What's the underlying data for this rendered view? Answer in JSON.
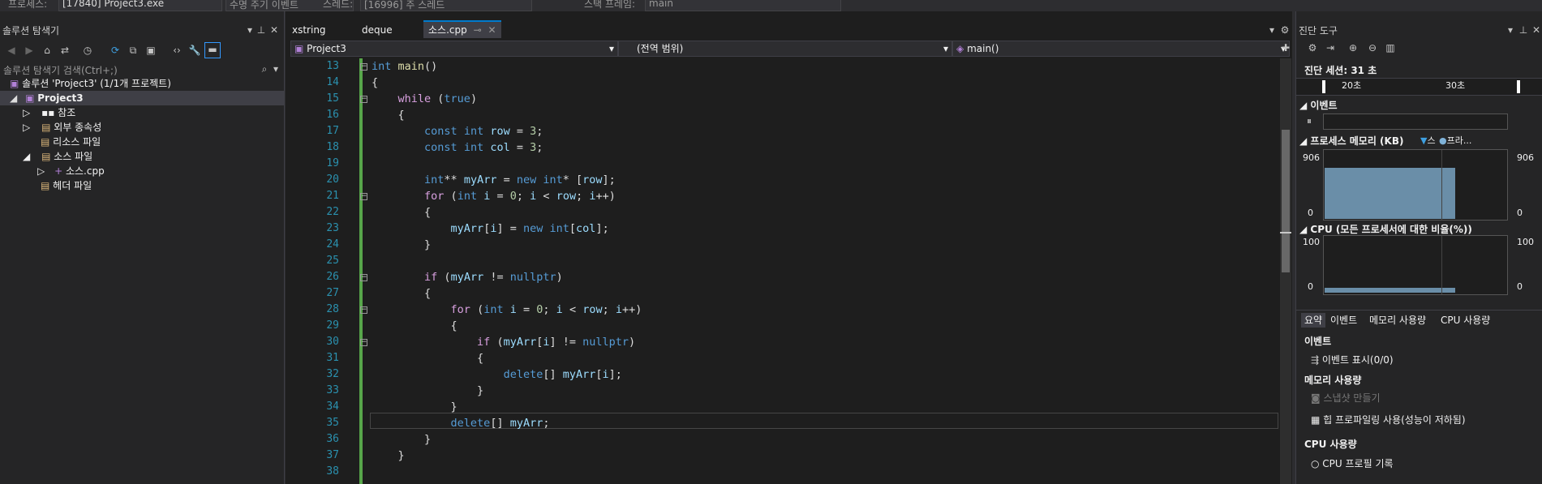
{
  "topbar": {
    "process_label": "프로세스:",
    "process_value": "[17840] Project3.exe",
    "lifecycle_label": "수명 주기 이벤트",
    "thread_label": "스레드:",
    "thread_value": "[16996] 주 스레드",
    "stack_label": "스택 프레임:",
    "stack_value": "main"
  },
  "solution_explorer": {
    "title": "솔루션 탐색기",
    "search_placeholder": "솔루션 탐색기 검색(Ctrl+;)",
    "tree": [
      {
        "label": "솔루션 'Project3' (1/1개 프로젝트)"
      },
      {
        "label": "Project3"
      },
      {
        "label": "참조"
      },
      {
        "label": "외부 종속성"
      },
      {
        "label": "리소스 파일"
      },
      {
        "label": "소스 파일"
      },
      {
        "label": "소스.cpp"
      },
      {
        "label": "헤더 파일"
      }
    ]
  },
  "editor": {
    "tabs": [
      {
        "label": "xstring"
      },
      {
        "label": "deque"
      },
      {
        "label": "소스.cpp"
      }
    ],
    "nav": {
      "project": "Project3",
      "scope": "(전역 범위)",
      "member": "main()"
    },
    "lines": [
      {
        "num": "13",
        "tokens": [
          [
            "kw",
            "int"
          ],
          [
            "t",
            " "
          ],
          [
            "fn",
            "main"
          ],
          [
            "t",
            "()"
          ]
        ]
      },
      {
        "num": "14",
        "tokens": [
          [
            "t",
            "{"
          ]
        ]
      },
      {
        "num": "15",
        "tokens": [
          [
            "t",
            "    "
          ],
          [
            "ctl",
            "while"
          ],
          [
            "t",
            " ("
          ],
          [
            "kw",
            "true"
          ],
          [
            "t",
            ")"
          ]
        ]
      },
      {
        "num": "16",
        "tokens": [
          [
            "t",
            "    {"
          ]
        ]
      },
      {
        "num": "17",
        "tokens": [
          [
            "t",
            "        "
          ],
          [
            "kw",
            "const"
          ],
          [
            "t",
            " "
          ],
          [
            "kw",
            "int"
          ],
          [
            "t",
            " "
          ],
          [
            "var",
            "row"
          ],
          [
            "t",
            " = "
          ],
          [
            "num",
            "3"
          ],
          [
            "t",
            ";"
          ]
        ]
      },
      {
        "num": "18",
        "tokens": [
          [
            "t",
            "        "
          ],
          [
            "kw",
            "const"
          ],
          [
            "t",
            " "
          ],
          [
            "kw",
            "int"
          ],
          [
            "t",
            " "
          ],
          [
            "var",
            "col"
          ],
          [
            "t",
            " = "
          ],
          [
            "num",
            "3"
          ],
          [
            "t",
            ";"
          ]
        ]
      },
      {
        "num": "19",
        "tokens": []
      },
      {
        "num": "20",
        "tokens": [
          [
            "t",
            "        "
          ],
          [
            "kw",
            "int"
          ],
          [
            "t",
            "** "
          ],
          [
            "var",
            "myArr"
          ],
          [
            "t",
            " = "
          ],
          [
            "kw",
            "new"
          ],
          [
            "t",
            " "
          ],
          [
            "kw",
            "int"
          ],
          [
            "t",
            "* ["
          ],
          [
            "var",
            "row"
          ],
          [
            "t",
            "];"
          ]
        ]
      },
      {
        "num": "21",
        "tokens": [
          [
            "t",
            "        "
          ],
          [
            "ctl",
            "for"
          ],
          [
            "t",
            " ("
          ],
          [
            "kw",
            "int"
          ],
          [
            "t",
            " "
          ],
          [
            "var",
            "i"
          ],
          [
            "t",
            " = "
          ],
          [
            "num",
            "0"
          ],
          [
            "t",
            "; "
          ],
          [
            "var",
            "i"
          ],
          [
            "t",
            " < "
          ],
          [
            "var",
            "row"
          ],
          [
            "t",
            "; "
          ],
          [
            "var",
            "i"
          ],
          [
            "t",
            "++)"
          ]
        ]
      },
      {
        "num": "22",
        "tokens": [
          [
            "t",
            "        {"
          ]
        ]
      },
      {
        "num": "23",
        "tokens": [
          [
            "t",
            "            "
          ],
          [
            "var",
            "myArr"
          ],
          [
            "t",
            "["
          ],
          [
            "var",
            "i"
          ],
          [
            "t",
            "] = "
          ],
          [
            "kw",
            "new"
          ],
          [
            "t",
            " "
          ],
          [
            "kw",
            "int"
          ],
          [
            "t",
            "["
          ],
          [
            "var",
            "col"
          ],
          [
            "t",
            "];"
          ]
        ]
      },
      {
        "num": "24",
        "tokens": [
          [
            "t",
            "        }"
          ]
        ]
      },
      {
        "num": "25",
        "tokens": []
      },
      {
        "num": "26",
        "tokens": [
          [
            "t",
            "        "
          ],
          [
            "ctl",
            "if"
          ],
          [
            "t",
            " ("
          ],
          [
            "var",
            "myArr"
          ],
          [
            "t",
            " != "
          ],
          [
            "kw",
            "nullptr"
          ],
          [
            "t",
            ")"
          ]
        ]
      },
      {
        "num": "27",
        "tokens": [
          [
            "t",
            "        {"
          ]
        ]
      },
      {
        "num": "28",
        "tokens": [
          [
            "t",
            "            "
          ],
          [
            "ctl",
            "for"
          ],
          [
            "t",
            " ("
          ],
          [
            "kw",
            "int"
          ],
          [
            "t",
            " "
          ],
          [
            "var",
            "i"
          ],
          [
            "t",
            " = "
          ],
          [
            "num",
            "0"
          ],
          [
            "t",
            "; "
          ],
          [
            "var",
            "i"
          ],
          [
            "t",
            " < "
          ],
          [
            "var",
            "row"
          ],
          [
            "t",
            "; "
          ],
          [
            "var",
            "i"
          ],
          [
            "t",
            "++)"
          ]
        ]
      },
      {
        "num": "29",
        "tokens": [
          [
            "t",
            "            {"
          ]
        ]
      },
      {
        "num": "30",
        "tokens": [
          [
            "t",
            "                "
          ],
          [
            "ctl",
            "if"
          ],
          [
            "t",
            " ("
          ],
          [
            "var",
            "myArr"
          ],
          [
            "t",
            "["
          ],
          [
            "var",
            "i"
          ],
          [
            "t",
            "] != "
          ],
          [
            "kw",
            "nullptr"
          ],
          [
            "t",
            ")"
          ]
        ]
      },
      {
        "num": "31",
        "tokens": [
          [
            "t",
            "                {"
          ]
        ]
      },
      {
        "num": "32",
        "tokens": [
          [
            "t",
            "                    "
          ],
          [
            "kw",
            "delete"
          ],
          [
            "t",
            "[] "
          ],
          [
            "var",
            "myArr"
          ],
          [
            "t",
            "["
          ],
          [
            "var",
            "i"
          ],
          [
            "t",
            "];"
          ]
        ]
      },
      {
        "num": "33",
        "tokens": [
          [
            "t",
            "                }"
          ]
        ]
      },
      {
        "num": "34",
        "tokens": [
          [
            "t",
            "            }"
          ]
        ]
      },
      {
        "num": "35",
        "tokens": [
          [
            "t",
            "            "
          ],
          [
            "kw",
            "delete"
          ],
          [
            "t",
            "[] "
          ],
          [
            "var",
            "myArr"
          ],
          [
            "t",
            ";"
          ]
        ]
      },
      {
        "num": "36",
        "tokens": [
          [
            "t",
            "        }"
          ]
        ]
      },
      {
        "num": "37",
        "tokens": [
          [
            "t",
            "    }"
          ]
        ]
      },
      {
        "num": "38",
        "tokens": []
      }
    ]
  },
  "diagnostics": {
    "title": "진단 도구",
    "session": "진단 세션: 31 초",
    "timeline_ticks": [
      "20초",
      "30초"
    ],
    "events_header": "이벤트",
    "memory_header": "프로세스 메모리 (KB)",
    "memory_legend": [
      "스",
      "프라..."
    ],
    "memory_max_left": "906",
    "memory_max_right": "906",
    "memory_min_left": "0",
    "memory_min_right": "0",
    "cpu_header": "CPU (모든 프로세서에 대한 비율(%))",
    "cpu_max_left": "100",
    "cpu_max_right": "100",
    "cpu_min_left": "0",
    "cpu_min_right": "0",
    "tabs": [
      "요약",
      "이벤트",
      "메모리 사용량",
      "CPU 사용량"
    ],
    "events_title": "이벤트",
    "events_show": "이벤트 표시(0/0)",
    "memory_title": "메모리 사용량",
    "snapshot": "스냅샷 만들기",
    "heap_profiling": "힙 프로파일링 사용(성능이 저하됨)",
    "cpu_title": "CPU 사용량",
    "cpu_profile": "CPU 프로필 기록",
    "colors": {
      "memory_fill": "#6a8ea8",
      "accent": "#007acc",
      "legend_private": "#7fb2d8"
    }
  }
}
